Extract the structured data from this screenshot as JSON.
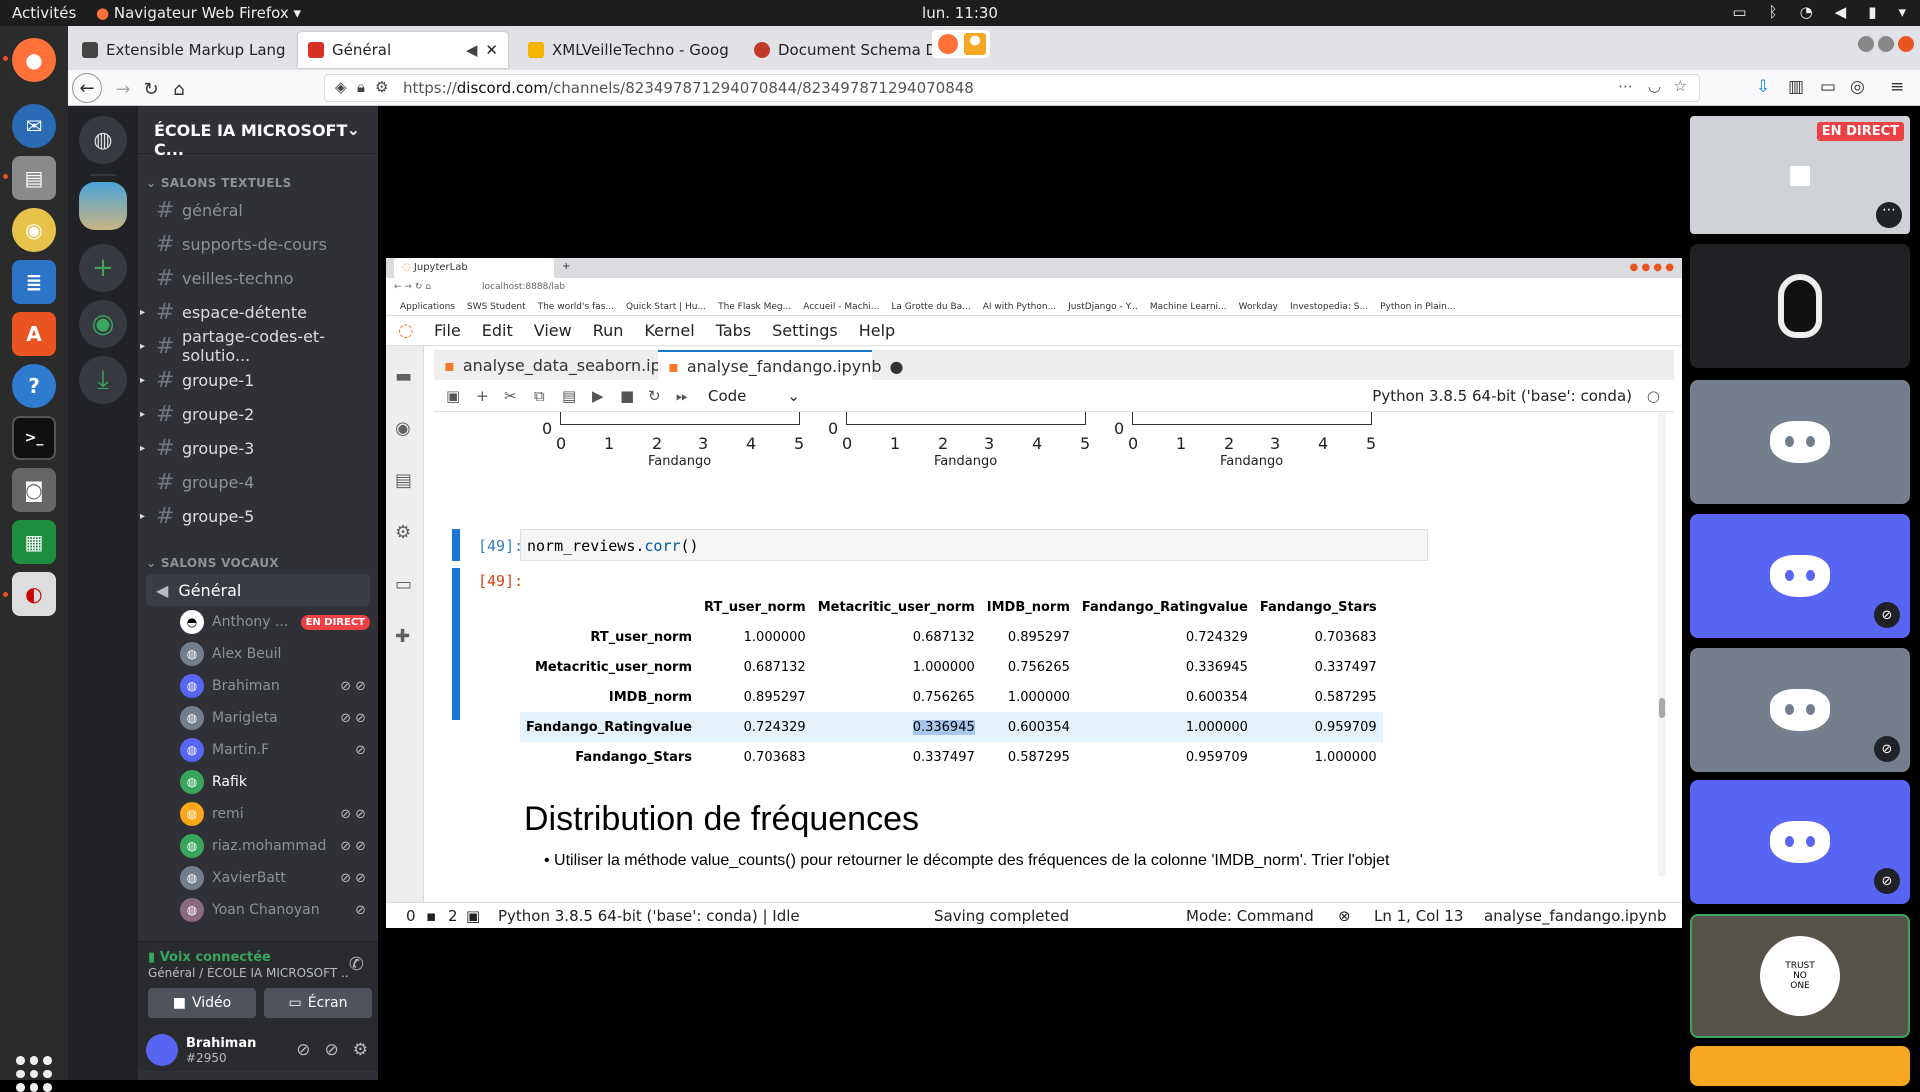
{
  "topbar": {
    "activities": "Activités",
    "app_name": "Navigateur Web Firefox",
    "clock": "lun. 11:30"
  },
  "firefox": {
    "tabs": [
      {
        "label": "Extensible Markup Lang",
        "fav_color": "#444444"
      },
      {
        "label": "Général",
        "fav_color": "#d93025"
      },
      {
        "label": "XMLVeilleTechno - Goog",
        "fav_color": "#f4b400"
      },
      {
        "label": "Document Schema Defi",
        "fav_color": "#c0392b"
      }
    ],
    "url_prefix": "https://",
    "url_domain": "discord.com",
    "url_path": "/channels/823497871294070844/823497871294070848"
  },
  "server": {
    "name": "ÉCOLE IA MICROSOFT C...",
    "text_category": "SALONS TEXTUELS",
    "text_channels": [
      {
        "name": "général"
      },
      {
        "name": "supports-de-cours"
      },
      {
        "name": "veilles-techno"
      },
      {
        "name": "espace-détente"
      },
      {
        "name": "partage-codes-et-solutio..."
      },
      {
        "name": "groupe-1"
      },
      {
        "name": "groupe-2"
      },
      {
        "name": "groupe-3"
      },
      {
        "name": "groupe-4"
      },
      {
        "name": "groupe-5"
      }
    ],
    "voice_category": "SALONS VOCAUX",
    "voice_channel": "Général",
    "voice_users": [
      {
        "name": "Anthony ...",
        "live": "EN DIRECT"
      },
      {
        "name": "Alex Beuil"
      },
      {
        "name": "Brahiman"
      },
      {
        "name": "Marigleta"
      },
      {
        "name": "Martin.F"
      },
      {
        "name": "Rafik"
      },
      {
        "name": "remi"
      },
      {
        "name": "riaz.mohammad"
      },
      {
        "name": "XavierBatt"
      },
      {
        "name": "Yoan Chanoyan"
      }
    ]
  },
  "voice_panel": {
    "status": "Voix connectée",
    "location": "Général / ÉCOLE IA MICROSOFT ...",
    "video_btn": "Vidéo",
    "screen_btn": "Écran",
    "username": "Brahiman",
    "tag": "#2950"
  },
  "stream": {
    "chrome_tab": "JupyterLab",
    "address": "localhost:8888/lab",
    "bookmarks": [
      "Applications",
      "SWS Student",
      "The world's fas...",
      "Quick Start | Hu...",
      "The Flask Meg...",
      "Accueil - Machi...",
      "La Grotte du Ba...",
      "AI with Python...",
      "JustDjango - Y...",
      "Machine Learni...",
      "Workday",
      "Investopedia: S...",
      "Python in Plain..."
    ],
    "menu": [
      "File",
      "Edit",
      "View",
      "Run",
      "Kernel",
      "Tabs",
      "Settings",
      "Help"
    ],
    "tabs": [
      "analyse_data_seaborn.ipy",
      "analyse_fandango.ipynb"
    ],
    "cell_type": "Code",
    "kernel": "Python 3.8.5 64-bit ('base': conda)",
    "plot_ticks": [
      "0",
      "1",
      "2",
      "3",
      "4",
      "5"
    ],
    "plot_y_tick": "0",
    "plot_xlabel": "Fandango",
    "in_prompt": "[49]:",
    "out_prompt": "[49]:",
    "code_obj": "norm_reviews.",
    "code_fn": "corr",
    "code_tail": "()",
    "table": {
      "columns": [
        "RT_user_norm",
        "Metacritic_user_norm",
        "IMDB_norm",
        "Fandango_Ratingvalue",
        "Fandango_Stars"
      ],
      "rows": [
        {
          "index": "RT_user_norm",
          "values": [
            "1.000000",
            "0.687132",
            "0.895297",
            "0.724329",
            "0.703683"
          ]
        },
        {
          "index": "Metacritic_user_norm",
          "values": [
            "0.687132",
            "1.000000",
            "0.756265",
            "0.336945",
            "0.337497"
          ]
        },
        {
          "index": "IMDB_norm",
          "values": [
            "0.895297",
            "0.756265",
            "1.000000",
            "0.600354",
            "0.587295"
          ]
        },
        {
          "index": "Fandango_Ratingvalue",
          "values": [
            "0.724329",
            "0.336945",
            "0.600354",
            "1.000000",
            "0.959709"
          ]
        },
        {
          "index": "Fandango_Stars",
          "values": [
            "0.703683",
            "0.337497",
            "0.587295",
            "0.959709",
            "1.000000"
          ]
        }
      ]
    },
    "md_heading": "Distribution de fréquences",
    "md_bullet": "Utiliser la méthode value_counts() pour retourner le décompte des fréquences de la colonne 'IMDB_norm'. Trier l'objet",
    "status": {
      "zero": "0",
      "two": "2",
      "kernel_state": "Python 3.8.5 64-bit ('base': conda) | Idle",
      "saving": "Saving completed",
      "mode": "Mode: Command",
      "cursor": "Ln 1, Col 13",
      "file": "analyse_fandango.ipynb"
    }
  },
  "video_tiles": {
    "live_badge": "EN DIRECT",
    "avatar_text": [
      "TRUST",
      "NO",
      "ONE"
    ]
  }
}
